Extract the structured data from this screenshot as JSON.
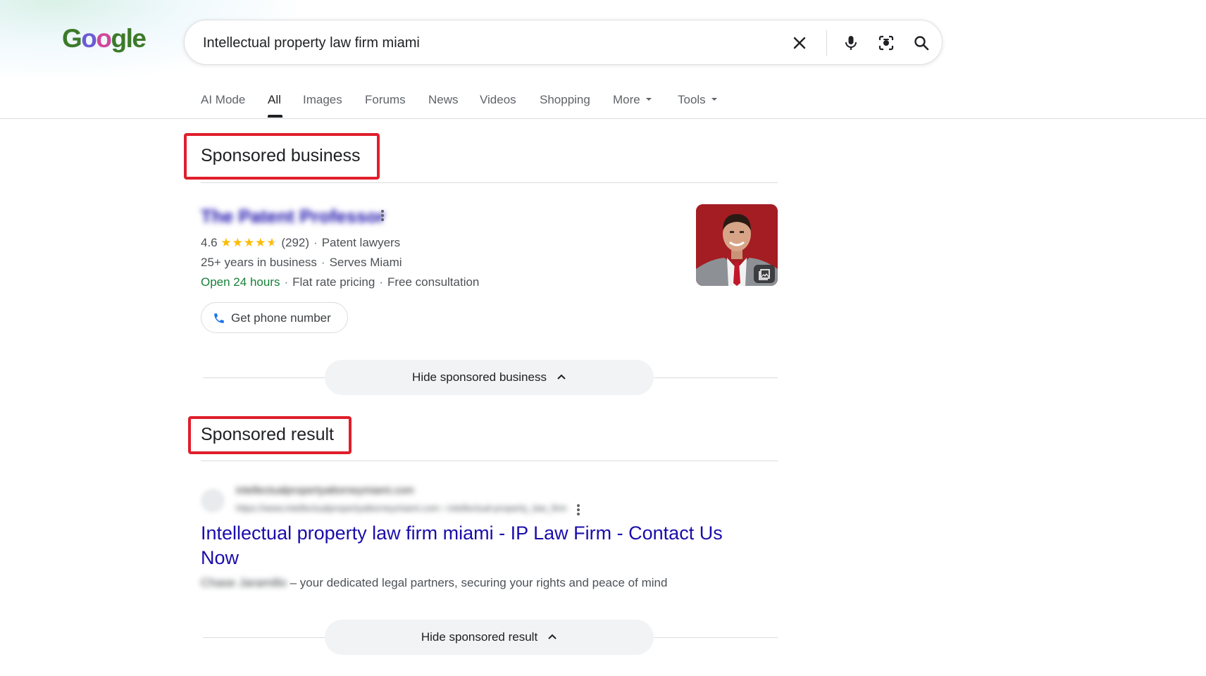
{
  "logo": {
    "text": "Google"
  },
  "search": {
    "query": "Intellectual property law firm miami",
    "icons": [
      "close-icon",
      "microphone-icon",
      "camera-lens-icon",
      "search-icon"
    ]
  },
  "tabs": [
    {
      "label": "AI Mode",
      "active": false
    },
    {
      "label": "All",
      "active": true
    },
    {
      "label": "Images",
      "active": false
    },
    {
      "label": "Forums",
      "active": false
    },
    {
      "label": "News",
      "active": false
    },
    {
      "label": "Videos",
      "active": false
    },
    {
      "label": "Shopping",
      "active": false
    },
    {
      "label": "More",
      "active": false,
      "dropdown": true
    },
    {
      "label": "Tools",
      "active": false,
      "dropdown": true
    }
  ],
  "sponsored_business": {
    "heading": "Sponsored business",
    "name": "The Patent Professor",
    "rating": "4.6",
    "stars": "★★★★",
    "half_star": "★",
    "reviews": "(292)",
    "category": "Patent lawyers",
    "years": "25+ years in business",
    "serves": "Serves Miami",
    "open": "Open 24 hours",
    "pricing": "Flat rate pricing",
    "consultation": "Free consultation",
    "phone_button": "Get phone number",
    "hide_button": "Hide sponsored business"
  },
  "sponsored_result": {
    "heading": "Sponsored result",
    "site_name": "intellectualpropertyattorneymiami.com",
    "site_url": "https://www.intellectualpropertyattorneymiami.com › intellectual-property_law_firm",
    "title": "Intellectual property law firm miami - IP Law Firm - Contact Us Now",
    "desc_prefix": "Chase Jaramillo",
    "desc": " – your dedicated legal partners, securing your rights and peace of mind",
    "hide_button": "Hide sponsored result"
  },
  "colors": {
    "highlight": "#e01e2b",
    "link": "#1a0dab",
    "open_green": "#188038",
    "star": "#fbbc04"
  }
}
